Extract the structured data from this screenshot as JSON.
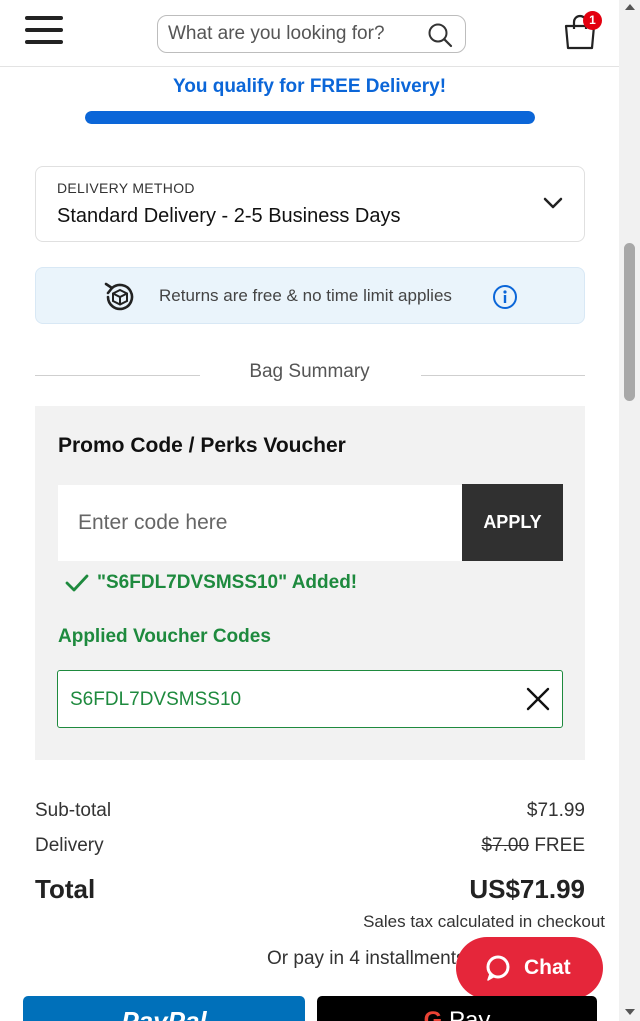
{
  "header": {
    "search_placeholder": "What are you looking for?",
    "bag_count": "1",
    "icons": [
      "hamburger-menu-icon",
      "search-icon",
      "shopping-bag-icon"
    ]
  },
  "delivery_banner": {
    "message": "You qualify for FREE Delivery!",
    "progress_fraction": 1.0,
    "color": "#0b66d8"
  },
  "delivery_method": {
    "label": "DELIVERY METHOD",
    "value": "Standard Delivery - 2-5 Business Days",
    "icon": "chevron-down-icon"
  },
  "returns": {
    "text": "Returns are free & no time limit applies",
    "icons": [
      "returns-box-icon",
      "info-icon"
    ]
  },
  "bag_summary": {
    "title": "Bag Summary"
  },
  "promo": {
    "title": "Promo Code / Perks Voucher",
    "input_placeholder": "Enter code here",
    "apply_label": "APPLY",
    "added_message": "\"S6FDL7DVSMSS10\" Added!",
    "applied_title": "Applied Voucher Codes",
    "applied_codes": [
      "S6FDL7DVSMSS10"
    ],
    "success_color": "#1e8a3e"
  },
  "totals": {
    "subtotal_label": "Sub-total",
    "subtotal_value": "$71.99",
    "delivery_label": "Delivery",
    "delivery_original": "$7.00",
    "delivery_value": "FREE",
    "total_label": "Total",
    "total_value": "US$71.99",
    "tax_note": "Sales tax calculated in checkout",
    "installments": "Or pay in 4 installments"
  },
  "chat": {
    "label": "Chat",
    "color": "#e5263a"
  },
  "payment_buttons": {
    "paypal_label": "PayPal",
    "gpay_label": "Pay"
  }
}
